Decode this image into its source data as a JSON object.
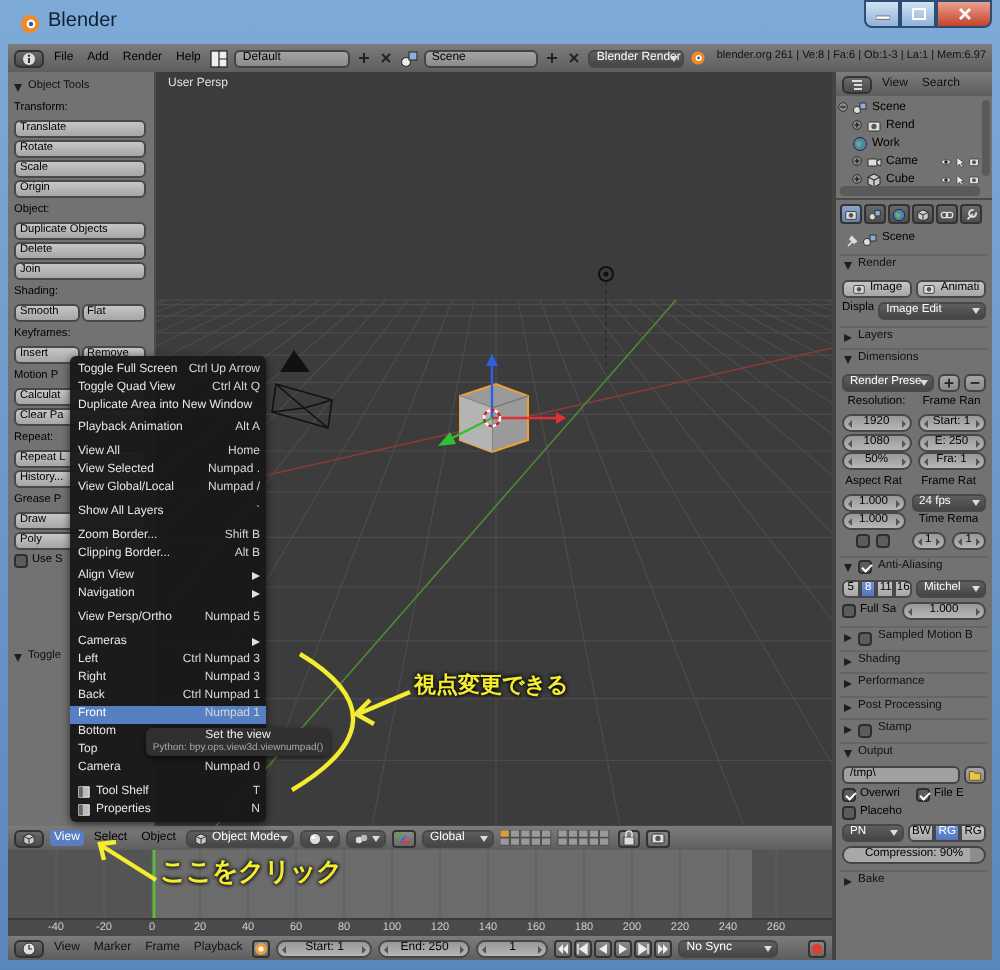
{
  "window": {
    "title": "Blender"
  },
  "info_header": {
    "menus": [
      "File",
      "Add",
      "Render",
      "Help"
    ],
    "layout": "Default",
    "scene": "Scene",
    "engine": "Blender Render",
    "stats": "blender.org 261 | Ve:8 | Fa:6 | Ob:1-3 | La:1 | Mem:6.97"
  },
  "tool_shelf": {
    "panels": [
      {
        "title": "Object Tools",
        "expanded": true,
        "rows": [
          {
            "kind": "label",
            "text": "Transform:"
          },
          {
            "kind": "buttons",
            "labels": [
              "Translate"
            ]
          },
          {
            "kind": "buttons",
            "labels": [
              "Rotate"
            ]
          },
          {
            "kind": "buttons",
            "labels": [
              "Scale"
            ]
          },
          {
            "kind": "buttons",
            "labels": [
              "Origin"
            ]
          },
          {
            "kind": "label",
            "text": "Object:"
          },
          {
            "kind": "buttons",
            "labels": [
              "Duplicate Objects"
            ]
          },
          {
            "kind": "buttons",
            "labels": [
              "Delete"
            ]
          },
          {
            "kind": "buttons",
            "labels": [
              "Join"
            ]
          },
          {
            "kind": "label",
            "text": "Shading:"
          },
          {
            "kind": "buttons",
            "labels": [
              "Smooth",
              "Flat"
            ]
          },
          {
            "kind": "label",
            "text": "Keyframes:"
          },
          {
            "kind": "buttons",
            "labels": [
              "Insert",
              "Remove"
            ]
          },
          {
            "kind": "label",
            "text": "Motion P"
          },
          {
            "kind": "buttons",
            "labels": [
              "Calculat"
            ]
          },
          {
            "kind": "buttons",
            "labels": [
              "Clear Pa"
            ]
          },
          {
            "kind": "label",
            "text": "Repeat:"
          },
          {
            "kind": "buttons",
            "labels": [
              "Repeat L"
            ]
          },
          {
            "kind": "buttons",
            "labels": [
              "History..."
            ]
          },
          {
            "kind": "label",
            "text": "Grease P"
          },
          {
            "kind": "buttons",
            "labels": [
              "Draw"
            ]
          },
          {
            "kind": "buttons",
            "labels": [
              "Poly"
            ]
          },
          {
            "kind": "checkbox",
            "label": "Use S",
            "checked": false
          }
        ]
      },
      {
        "title": "Toggle",
        "expanded": true
      }
    ]
  },
  "viewport": {
    "label": "User Persp"
  },
  "view_menu": {
    "items": [
      {
        "kind": "item",
        "label": "Toggle Full Screen",
        "shortcut": "Ctrl Up Arrow",
        "selected": false
      },
      {
        "kind": "item",
        "label": "Toggle Quad View",
        "shortcut": "Ctrl Alt Q",
        "selected": false
      },
      {
        "kind": "item",
        "label": "Duplicate Area into New Window",
        "selected": false
      },
      {
        "kind": "separator"
      },
      {
        "kind": "item",
        "label": "Playback Animation",
        "shortcut": "Alt A",
        "selected": false
      },
      {
        "kind": "separator"
      },
      {
        "kind": "item",
        "label": "View All",
        "shortcut": "Home",
        "selected": false
      },
      {
        "kind": "item",
        "label": "View Selected",
        "shortcut": "Numpad .",
        "selected": false
      },
      {
        "kind": "item",
        "label": "View Global/Local",
        "shortcut": "Numpad /",
        "selected": false
      },
      {
        "kind": "separator"
      },
      {
        "kind": "item",
        "label": "Show All Layers",
        "shortcut": "`",
        "selected": false
      },
      {
        "kind": "separator"
      },
      {
        "kind": "item",
        "label": "Zoom Border...",
        "shortcut": "Shift B",
        "selected": false
      },
      {
        "kind": "item",
        "label": "Clipping Border...",
        "shortcut": "Alt B",
        "selected": false
      },
      {
        "kind": "separator"
      },
      {
        "kind": "submenu",
        "label": "Align View",
        "selected": false
      },
      {
        "kind": "submenu",
        "label": "Navigation",
        "selected": false
      },
      {
        "kind": "separator"
      },
      {
        "kind": "item",
        "label": "View Persp/Ortho",
        "shortcut": "Numpad 5",
        "selected": false
      },
      {
        "kind": "separator"
      },
      {
        "kind": "submenu",
        "label": "Cameras",
        "selected": false
      },
      {
        "kind": "item",
        "label": "Left",
        "shortcut": "Ctrl Numpad 3",
        "selected": false
      },
      {
        "kind": "item",
        "label": "Right",
        "shortcut": "Numpad 3",
        "selected": false
      },
      {
        "kind": "item",
        "label": "Back",
        "shortcut": "Ctrl Numpad 1",
        "selected": false
      },
      {
        "kind": "item",
        "label": "Front",
        "shortcut": "Numpad 1",
        "selected": true
      },
      {
        "kind": "item",
        "label": "Bottom",
        "selected": false
      },
      {
        "kind": "item",
        "label": "Top",
        "selected": false
      },
      {
        "kind": "item",
        "label": "Camera",
        "shortcut": "Numpad 0",
        "selected": false
      },
      {
        "kind": "separator"
      },
      {
        "kind": "toggle",
        "label": "Tool Shelf",
        "shortcut": "T",
        "selected": false
      },
      {
        "kind": "toggle",
        "label": "Properties",
        "shortcut": "N",
        "selected": false
      }
    ]
  },
  "tooltip": {
    "title": "Set the view",
    "python": "Python: bpy.ops.view3d.viewnumpad()"
  },
  "annotations": [
    {
      "kind": "curved",
      "text": "視点変更できる"
    },
    {
      "kind": "straight",
      "text": "ここをクリック"
    }
  ],
  "viewport_header": {
    "menus": [
      {
        "label": "View",
        "selected": true
      },
      {
        "label": "Select",
        "selected": false
      },
      {
        "label": "Object",
        "selected": false
      }
    ],
    "mode": "Object Mode",
    "orientation": "Global"
  },
  "timeline": {
    "ticks": [
      "-40",
      "-20",
      "0",
      "20",
      "40",
      "60",
      "80",
      "100",
      "120",
      "140",
      "160",
      "180",
      "200",
      "220",
      "240",
      "260"
    ],
    "menus": [
      "View",
      "Marker",
      "Frame",
      "Playback"
    ],
    "start": "Start: 1",
    "end": "End: 250",
    "frame": "1",
    "sync": "No Sync"
  },
  "outliner": {
    "menus": [
      "View",
      "Search"
    ],
    "tree": [
      {
        "kind": "scene",
        "label": "Scene",
        "children": [
          {
            "kind": "render_layers",
            "label": "Rend"
          },
          {
            "kind": "world",
            "label": "Work"
          },
          {
            "kind": "camera",
            "label": "Came"
          },
          {
            "kind": "object",
            "label": "Cube"
          }
        ]
      }
    ]
  },
  "properties": {
    "tabs": [
      {
        "kind": "render",
        "selected": true
      },
      {
        "kind": "scene",
        "selected": false
      },
      {
        "kind": "world",
        "selected": false
      },
      {
        "kind": "object",
        "selected": false
      },
      {
        "kind": "constraint",
        "selected": false
      },
      {
        "kind": "modifier",
        "selected": false
      }
    ],
    "context": "Scene",
    "panels": [
      {
        "title": "Render",
        "expanded": true,
        "rows": [
          {
            "kind": "row",
            "items": [
              {
                "kind": "tool",
                "label": "Image"
              },
              {
                "kind": "tool",
                "label": "Animati"
              }
            ]
          },
          {
            "kind": "row",
            "items": [
              {
                "kind": "label",
                "text": "Displa"
              },
              {
                "kind": "dropdown",
                "value": "Image Edit"
              }
            ]
          }
        ]
      },
      {
        "title": "Layers",
        "expanded": false
      },
      {
        "title": "Dimensions",
        "expanded": true,
        "rows": [
          {
            "kind": "row",
            "items": [
              {
                "kind": "dropdown",
                "value": "Render Prese"
              },
              {
                "kind": "add"
              },
              {
                "kind": "remove"
              }
            ]
          },
          {
            "kind": "columns",
            "columns": [
              [
                {
                  "kind": "label",
                  "text": "Resolution:"
                },
                {
                  "kind": "number",
                  "value": "1920"
                },
                {
                  "kind": "number",
                  "value": "1080"
                },
                {
                  "kind": "number",
                  "value": "50%"
                }
              ],
              [
                {
                  "kind": "label",
                  "text": "Frame Ran"
                },
                {
                  "kind": "number",
                  "value": "Start: 1"
                },
                {
                  "kind": "number",
                  "value": "E: 250"
                },
                {
                  "kind": "number",
                  "value": "Fra: 1"
                }
              ]
            ]
          },
          {
            "kind": "columns",
            "columns": [
              [
                {
                  "kind": "label",
                  "text": "Aspect Rat"
                },
                {
                  "kind": "number",
                  "value": "1.000"
                },
                {
                  "kind": "number",
                  "value": "1.000"
                },
                {
                  "kind": "checks",
                  "items": [
                    {
                      "checked": false
                    },
                    {
                      "checked": false
                    }
                  ]
                }
              ],
              [
                {
                  "kind": "label",
                  "text": "Frame Rat"
                },
                {
                  "kind": "dropdown",
                  "value": "24 fps"
                },
                {
                  "kind": "label",
                  "text": "Time Rema"
                },
                {
                  "kind": "numbers",
                  "values": [
                    "1",
                    "1"
                  ]
                }
              ]
            ]
          }
        ]
      },
      {
        "title": "Anti-Aliasing",
        "expanded": true,
        "checked": true,
        "rows": [
          {
            "kind": "row",
            "items": [
              {
                "kind": "segmented",
                "items": [
                  {
                    "label": "5",
                    "selected": false
                  },
                  {
                    "label": "8",
                    "selected": true
                  },
                  {
                    "label": "11",
                    "selected": false
                  },
                  {
                    "label": "16",
                    "selected": false
                  }
                ]
              },
              {
                "kind": "dropdown",
                "value": "Mitchel"
              }
            ]
          },
          {
            "kind": "row",
            "items": [
              {
                "kind": "checkbox",
                "label": "Full Sa",
                "checked": false
              },
              {
                "kind": "number",
                "value": "1.000"
              }
            ]
          }
        ]
      },
      {
        "title": "Sampled Motion B",
        "expanded": false,
        "checked": false
      },
      {
        "title": "Shading",
        "expanded": false
      },
      {
        "title": "Performance",
        "expanded": false
      },
      {
        "title": "Post Processing",
        "expanded": false
      },
      {
        "title": "Stamp",
        "expanded": false,
        "checked": false
      },
      {
        "title": "Output",
        "expanded": true,
        "rows": [
          {
            "kind": "row",
            "items": [
              {
                "kind": "text",
                "value": "/tmp\\"
              },
              {
                "kind": "folder"
              }
            ]
          },
          {
            "kind": "row",
            "items": [
              {
                "kind": "checkbox",
                "label": "Overwri",
                "checked": true
              },
              {
                "kind": "checkbox",
                "label": "File E",
                "checked": true
              }
            ]
          },
          {
            "kind": "row",
            "items": [
              {
                "kind": "checkbox",
                "label": "Placeho",
                "checked": false
              }
            ]
          },
          {
            "kind": "row",
            "items": [
              {
                "kind": "dropdown",
                "value": "PN"
              },
              {
                "kind": "segmented",
                "items": [
                  {
                    "label": "BW",
                    "selected": false
                  },
                  {
                    "label": "RG",
                    "selected": true
                  },
                  {
                    "label": "RG",
                    "selected": false
                  }
                ]
              }
            ]
          },
          {
            "kind": "row",
            "items": [
              {
                "kind": "slider",
                "label": "Compression: 90%",
                "level": 0.9
              }
            ]
          }
        ]
      },
      {
        "title": "Bake",
        "expanded": false
      }
    ]
  }
}
